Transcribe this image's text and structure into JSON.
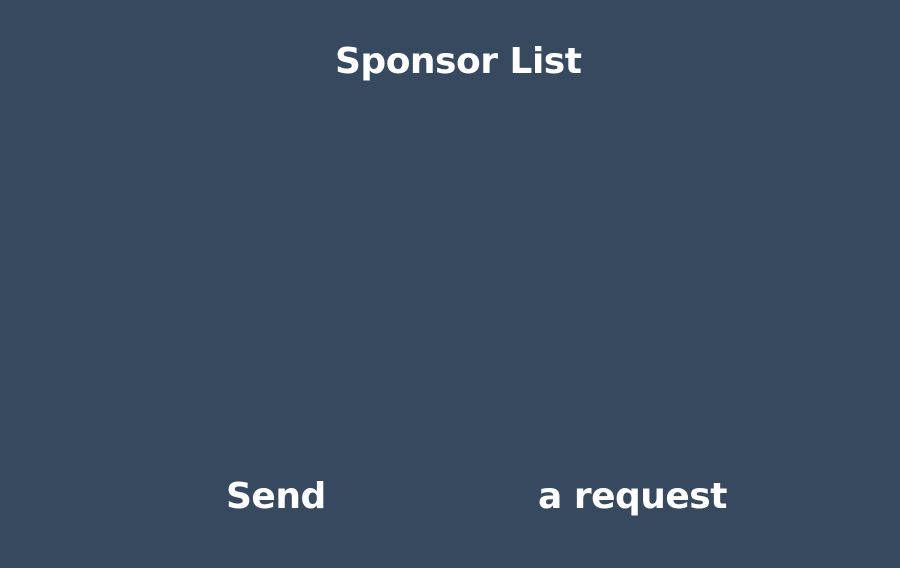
{
  "header": {
    "title": "Sponsor List"
  },
  "sponsor_list": {
    "items": []
  },
  "footer": {
    "send_label": "Send",
    "request_label": "a request"
  }
}
